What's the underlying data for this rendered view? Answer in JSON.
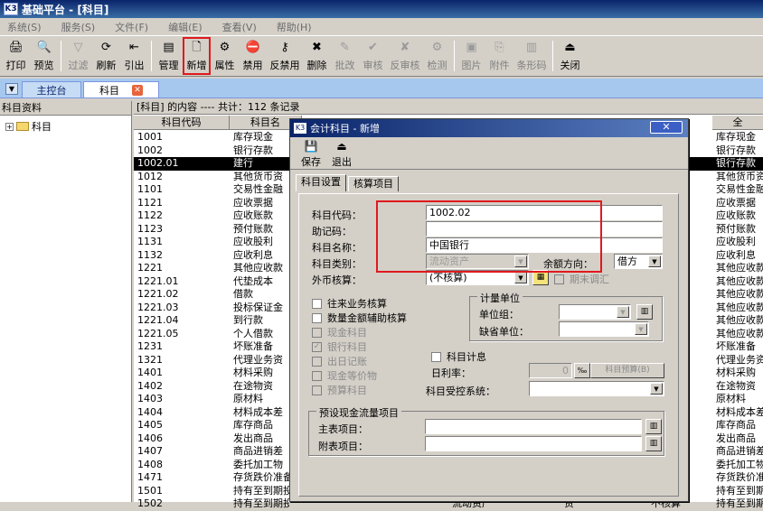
{
  "app": {
    "title": "基础平台 - [科目]",
    "logo": "K3"
  },
  "menu": [
    "系统(S)",
    "服务(S)",
    "文件(F)",
    "编辑(E)",
    "查看(V)",
    "帮助(H)"
  ],
  "toolbar": [
    {
      "label": "打印",
      "icon": "🖨",
      "enabled": true
    },
    {
      "label": "预览",
      "icon": "🔍",
      "enabled": true
    },
    {
      "sep": true
    },
    {
      "label": "过滤",
      "icon": "▽",
      "enabled": false
    },
    {
      "label": "刷新",
      "icon": "⟳",
      "enabled": true
    },
    {
      "label": "引出",
      "icon": "⇤",
      "enabled": true
    },
    {
      "sep": true
    },
    {
      "label": "管理",
      "icon": "▤",
      "enabled": true
    },
    {
      "label": "新增",
      "icon": "🗋",
      "enabled": true,
      "highlight": true
    },
    {
      "label": "属性",
      "icon": "⚙",
      "enabled": true
    },
    {
      "label": "禁用",
      "icon": "⛔",
      "enabled": true
    },
    {
      "label": "反禁用",
      "icon": "⚷",
      "enabled": true
    },
    {
      "label": "删除",
      "icon": "✖",
      "enabled": true
    },
    {
      "label": "批改",
      "icon": "✎",
      "enabled": false
    },
    {
      "label": "审核",
      "icon": "✔",
      "enabled": false
    },
    {
      "label": "反审核",
      "icon": "✘",
      "enabled": false
    },
    {
      "label": "检测",
      "icon": "⚙",
      "enabled": false
    },
    {
      "sep": true
    },
    {
      "label": "图片",
      "icon": "▣",
      "enabled": false
    },
    {
      "label": "附件",
      "icon": "⎘",
      "enabled": false
    },
    {
      "label": "条形码",
      "icon": "▥",
      "enabled": false
    },
    {
      "sep": true
    },
    {
      "label": "关闭",
      "icon": "⏏",
      "enabled": true
    }
  ],
  "tabs": {
    "main": "主控台",
    "active": "科目"
  },
  "left": {
    "header": "科目资料",
    "tree_root": "科目"
  },
  "grid": {
    "header": "[科目] 的内容 ---- 共计：112 条记录",
    "col1": "科目代码",
    "col2": "科目名",
    "col_last": "全",
    "rows": [
      [
        "1001",
        "库存现金",
        "",
        "",
        "",
        "库存现金"
      ],
      [
        "1002",
        "银行存款",
        "",
        "",
        "",
        "银行存款"
      ],
      [
        "1002.01",
        "建行",
        "",
        "",
        "",
        "银行存款"
      ],
      [
        "1012",
        "其他货币资",
        "",
        "",
        "",
        "其他货币资"
      ],
      [
        "1101",
        "交易性金融",
        "",
        "",
        "",
        "交易性金融"
      ],
      [
        "1121",
        "应收票据",
        "",
        "",
        "",
        "应收票据"
      ],
      [
        "1122",
        "应收账款",
        "",
        "",
        "",
        "应收账款"
      ],
      [
        "1123",
        "预付账款",
        "",
        "",
        "",
        "预付账款"
      ],
      [
        "1131",
        "应收股利",
        "",
        "",
        "",
        "应收股利"
      ],
      [
        "1132",
        "应收利息",
        "",
        "",
        "",
        "应收利息"
      ],
      [
        "1221",
        "其他应收款",
        "",
        "",
        "",
        "其他应收款"
      ],
      [
        "1221.01",
        "代垫成本",
        "",
        "",
        "",
        "其他应收款"
      ],
      [
        "1221.02",
        "借款",
        "",
        "",
        "",
        "其他应收款"
      ],
      [
        "1221.03",
        "投标保证金",
        "",
        "",
        "",
        "其他应收款"
      ],
      [
        "1221.04",
        "到行款",
        "",
        "",
        "",
        "其他应收款"
      ],
      [
        "1221.05",
        "个人借款",
        "",
        "",
        "",
        "其他应收款"
      ],
      [
        "1231",
        "坏账准备",
        "",
        "",
        "",
        "坏账准备"
      ],
      [
        "1321",
        "代理业务资",
        "",
        "",
        "",
        "代理业务资"
      ],
      [
        "1401",
        "材料采购",
        "",
        "",
        "",
        "材料采购"
      ],
      [
        "1402",
        "在途物资",
        "",
        "",
        "",
        "在途物资"
      ],
      [
        "1403",
        "原材料",
        "",
        "",
        "",
        "原材料"
      ],
      [
        "1404",
        "材料成本差",
        "",
        "",
        "",
        "材料成本差"
      ],
      [
        "1405",
        "库存商品",
        "",
        "",
        "",
        "库存商品"
      ],
      [
        "1406",
        "发出商品",
        "",
        "",
        "",
        "发出商品"
      ],
      [
        "1407",
        "商品进销差",
        "",
        "",
        "",
        "商品进销差"
      ],
      [
        "1408",
        "委托加工物",
        "",
        "",
        "",
        "委托加工物"
      ],
      [
        "1471",
        "存货跌价准备",
        "流动资产",
        "贷",
        "不核算",
        "存货跌价准"
      ],
      [
        "1501",
        "持有至到期投资",
        "流动资产",
        "借",
        "不核算",
        "持有至到期"
      ],
      [
        "1502",
        "持有至到期投资减值",
        "流动资产",
        "贷",
        "不核算",
        "持有至到期"
      ]
    ]
  },
  "dialog": {
    "title": "会计科目 - 新增",
    "save": "保存",
    "exit": "退出",
    "tab1": "科目设置",
    "tab2": "核算项目",
    "code_label": "科目代码：",
    "code_value": "1002.02",
    "mnemonic_label": "助记码：",
    "mnemonic_value": "",
    "name_label": "科目名称：",
    "name_value": "中国银行",
    "category_label": "科目类别：",
    "category_value": "流动资产",
    "direction_label": "余额方向：",
    "direction_value": "借方",
    "currency_label": "外币核算：",
    "currency_value": "(不核算)",
    "period_adjust": "期末调汇",
    "checks": [
      {
        "label": "往来业务核算",
        "checked": false,
        "enabled": true
      },
      {
        "label": "数量金额辅助核算",
        "checked": false,
        "enabled": true
      },
      {
        "label": "现金科目",
        "checked": false,
        "enabled": false
      },
      {
        "label": "银行科目",
        "checked": true,
        "enabled": false
      },
      {
        "label": "出日记账",
        "checked": false,
        "enabled": false
      },
      {
        "label": "现金等价物",
        "checked": false,
        "enabled": false
      },
      {
        "label": "预算科目",
        "checked": false,
        "enabled": false
      }
    ],
    "unit_group": "计量单位",
    "unit_group_label": "单位组：",
    "default_unit_label": "缺省单位：",
    "interest": "科目计息",
    "daily_rate_label": "日利率：",
    "rate_value": "0",
    "rate_unit": "‰",
    "budget_btn": "科目预算(B)",
    "control_label": "科目受控系统：",
    "cashflow_group": "预设现金流量项目",
    "main_item": "主表项目：",
    "sub_item": "附表项目："
  },
  "colors": {
    "highlight": "#e0191e"
  }
}
